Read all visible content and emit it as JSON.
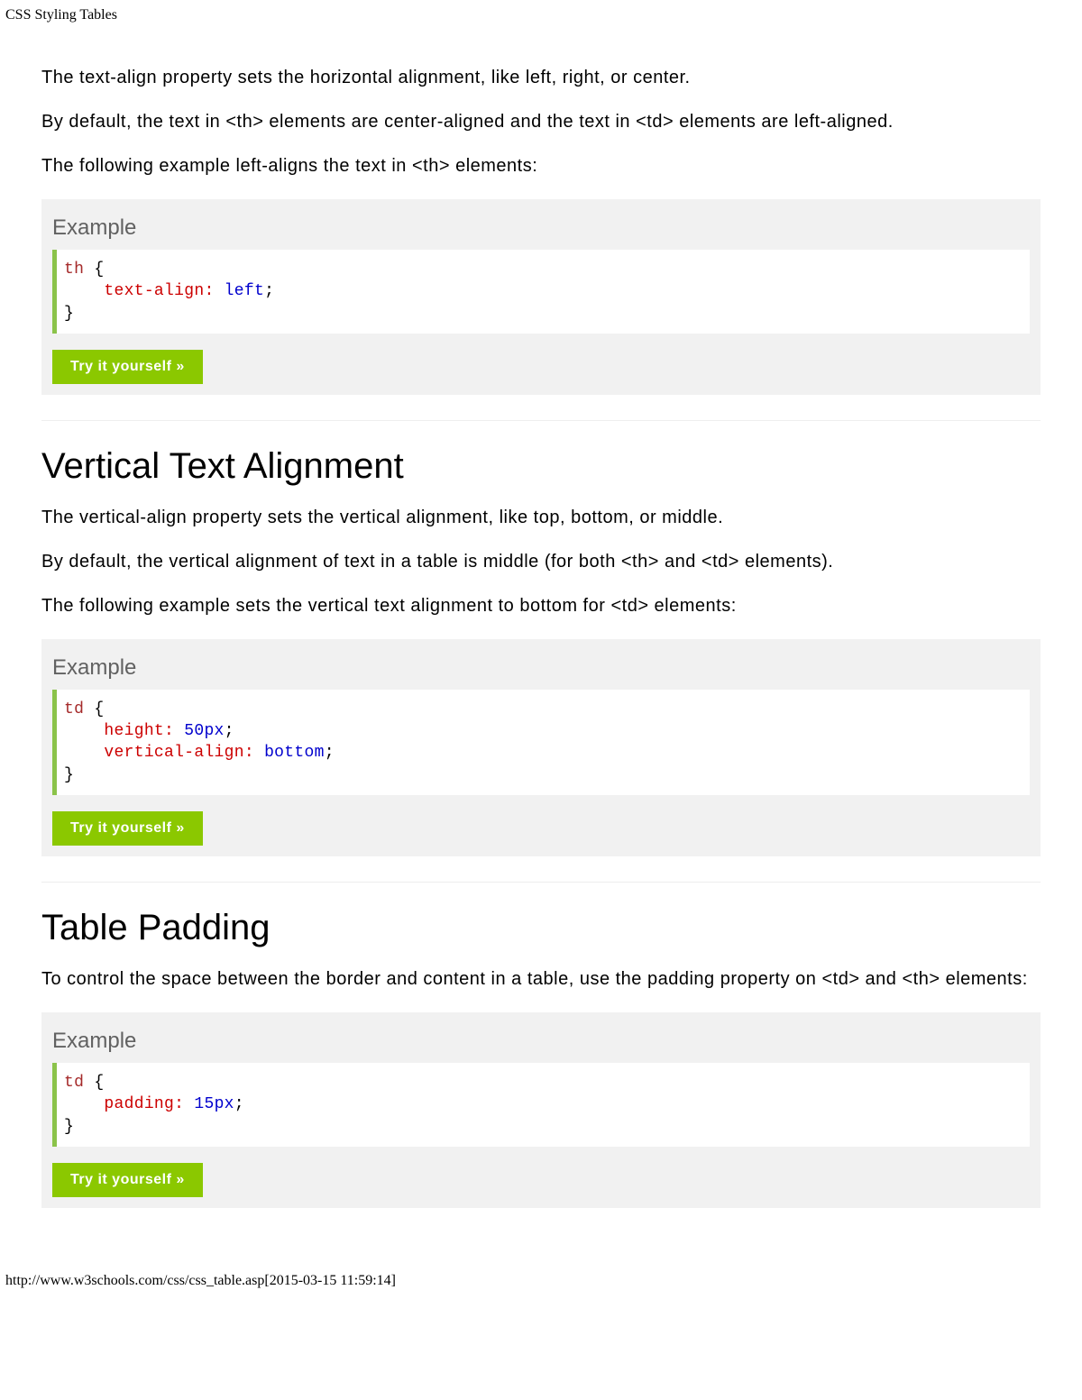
{
  "page": {
    "title": "CSS Styling Tables",
    "footer": "http://www.w3schools.com/css/css_table.asp[2015-03-15 11:59:14]"
  },
  "intro": {
    "p1": "The text-align property sets the horizontal alignment, like left, right, or center.",
    "p2": "By default, the text in <th> elements are center-aligned and the text in <td> elements are left-aligned.",
    "p3": "The following example left-aligns the text in <th> elements:"
  },
  "example1": {
    "label": "Example",
    "sel": "th",
    "prop1": "text-align:",
    "val1": "left",
    "btn": "Try it yourself »"
  },
  "section2": {
    "heading": "Vertical Text Alignment",
    "p1": "The vertical-align property sets the vertical alignment, like top, bottom, or middle.",
    "p2": "By default, the vertical alignment of text in a table is middle (for both <th> and <td> elements).",
    "p3": "The following example sets the vertical text alignment to bottom for <td> elements:"
  },
  "example2": {
    "label": "Example",
    "sel": "td",
    "prop1": "height:",
    "val1": "50px",
    "prop2": "vertical-align:",
    "val2": "bottom",
    "btn": "Try it yourself »"
  },
  "section3": {
    "heading": "Table Padding",
    "p1": "To control the space between the border and content in a table, use the padding property on <td> and <th> elements:"
  },
  "example3": {
    "label": "Example",
    "sel": "td",
    "prop1": "padding:",
    "val1": "15px",
    "btn": "Try it yourself »"
  }
}
